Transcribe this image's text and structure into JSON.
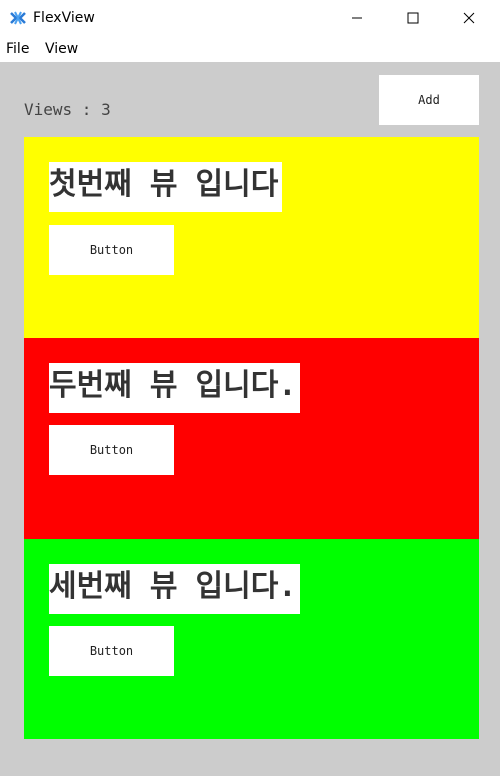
{
  "window": {
    "title": "FlexView"
  },
  "menu": {
    "items": [
      "File",
      "View"
    ]
  },
  "toolbar": {
    "views_label": "Views : 3",
    "add_label": "Add"
  },
  "panels": [
    {
      "label": "첫번째 뷰 입니다",
      "button": "Button",
      "color": "#ffff00"
    },
    {
      "label": "두번째 뷰 입니다.",
      "button": "Button",
      "color": "#ff0000"
    },
    {
      "label": "세번째 뷰 입니다.",
      "button": "Button",
      "color": "#00ff00"
    }
  ]
}
